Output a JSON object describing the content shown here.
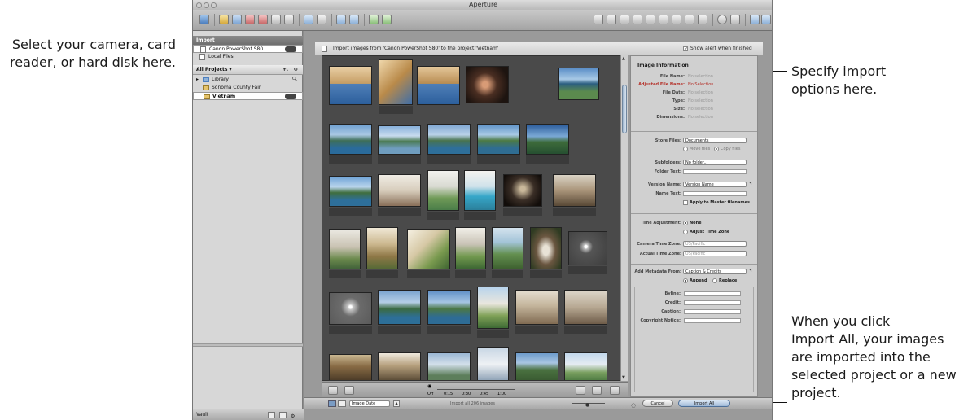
{
  "callouts": {
    "left": [
      "Select your camera, card",
      "reader, or hard disk here."
    ],
    "top_right": [
      "Specify import",
      "options here."
    ],
    "bottom_right": [
      "When you click",
      "Import All, your images",
      "are imported into the",
      "selected project or a new",
      "project."
    ]
  },
  "window": {
    "title": "Aperture"
  },
  "import_panel": {
    "header": "Import",
    "items": [
      "Canon PowerShot S80",
      "Local Files"
    ]
  },
  "projects_panel": {
    "header": "All Projects",
    "items": [
      "Library",
      "Sonoma County Fair",
      "Vietnam"
    ],
    "vault_label": "Vault"
  },
  "import_header": {
    "message": "Import images from 'Canon PowerShot S80' to the project 'Vietnam'",
    "show_alert_label": "Show alert when finished"
  },
  "image_info": {
    "title": "Image Information",
    "rows": [
      {
        "label": "File Name:",
        "value": "No selection"
      },
      {
        "label": "Adjusted File Name:",
        "value": "No Selection"
      },
      {
        "label": "File Date:",
        "value": "No selection"
      },
      {
        "label": "Type:",
        "value": "No selection"
      },
      {
        "label": "Size:",
        "value": "No selection"
      },
      {
        "label": "Dimensions:",
        "value": "No selection"
      }
    ]
  },
  "store_files": {
    "label": "Store Files:",
    "value": "Documents",
    "move_label": "Move files",
    "copy_label": "Copy files",
    "subfolders_label": "Subfolders:",
    "subfolders_value": "No folder...",
    "folder_text_label": "Folder Text:",
    "version_name_label": "Version Name:",
    "version_name_value": "Version Name",
    "name_text_label": "Name Text:",
    "apply_master_label": "Apply to Master filenames"
  },
  "time_adjustment": {
    "label": "Time Adjustment:",
    "none_label": "None",
    "adjust_label": "Adjust Time Zone",
    "camera_tz_label": "Camera Time Zone:",
    "camera_tz_value": "US/Pacific",
    "actual_tz_label": "Actual Time Zone:",
    "actual_tz_value": "US/Pacific"
  },
  "metadata": {
    "label": "Add Metadata From:",
    "value": "Caption & Credits",
    "append_label": "Append",
    "replace_label": "Replace",
    "fields": [
      "Byline:",
      "Credit:",
      "Caption:",
      "Copyright Notice:"
    ]
  },
  "slider": {
    "off": "Off",
    "ticks": [
      "0:15",
      "0:30",
      "0:45",
      "1:00"
    ]
  },
  "bottom_bar": {
    "sort_value": "Image Date",
    "status": "Import all 206 images",
    "cancel_label": "Cancel",
    "import_all_label": "Import All"
  },
  "colors": {
    "window_bg": "#8c8c8c",
    "grid_bg": "#4a4a4a",
    "adjusted_label": "#b5322a",
    "selection": "#4d7fbf"
  }
}
